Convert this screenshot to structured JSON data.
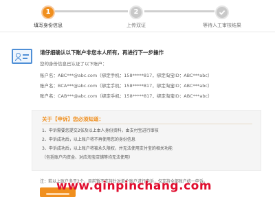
{
  "steps": [
    {
      "number": "1",
      "label": "填写身份信息",
      "state": "active"
    },
    {
      "number": "2",
      "label": "上传双证",
      "state": "pending"
    },
    {
      "icon": "check-icon",
      "label": "等待人工审核结果",
      "state": "pending"
    }
  ],
  "colors": {
    "accent": "#f08f1e",
    "info_blue": "#4f8fd6",
    "watermark": "#e00d2e"
  },
  "prompt": {
    "headline": "请仔细确认以下账户非您本人所有，再进行下一步操作",
    "subline": "您的身份信息已认证了以下账户："
  },
  "accounts": [
    "账户名：ABC***@abc.com（绑定手机：158*****817，绑定淘宝ID：ABC***abc）",
    "账户名：BCA***@abc.com（绑定手机：158*****817，绑定淘宝ID：ABC***abc）",
    "账户名：CAB***@abc.com（绑定手机：158*****817，绑定淘宝ID：ABC***abc）"
  ],
  "notice": {
    "title": "关于【申诉】您必须知道：",
    "items": [
      "1、申诉需要您提交2张及以上本人身份资料，由支付宝进行审核",
      "2、申诉成功后，以上账户将不再使用您的身份信息",
      "3、申诉成功后，以上账户将被永久限权，并无法使用支付宝的相关功能",
      "（包括账户内资金、对应淘宝店铺等均无法使用）"
    ]
  },
  "footnote": "注：若以上账户多于2个，目前暂不支持针对单个账户进行申诉，仅支持全部账户统一申诉。",
  "watermark": "www.qinpinchang.com"
}
